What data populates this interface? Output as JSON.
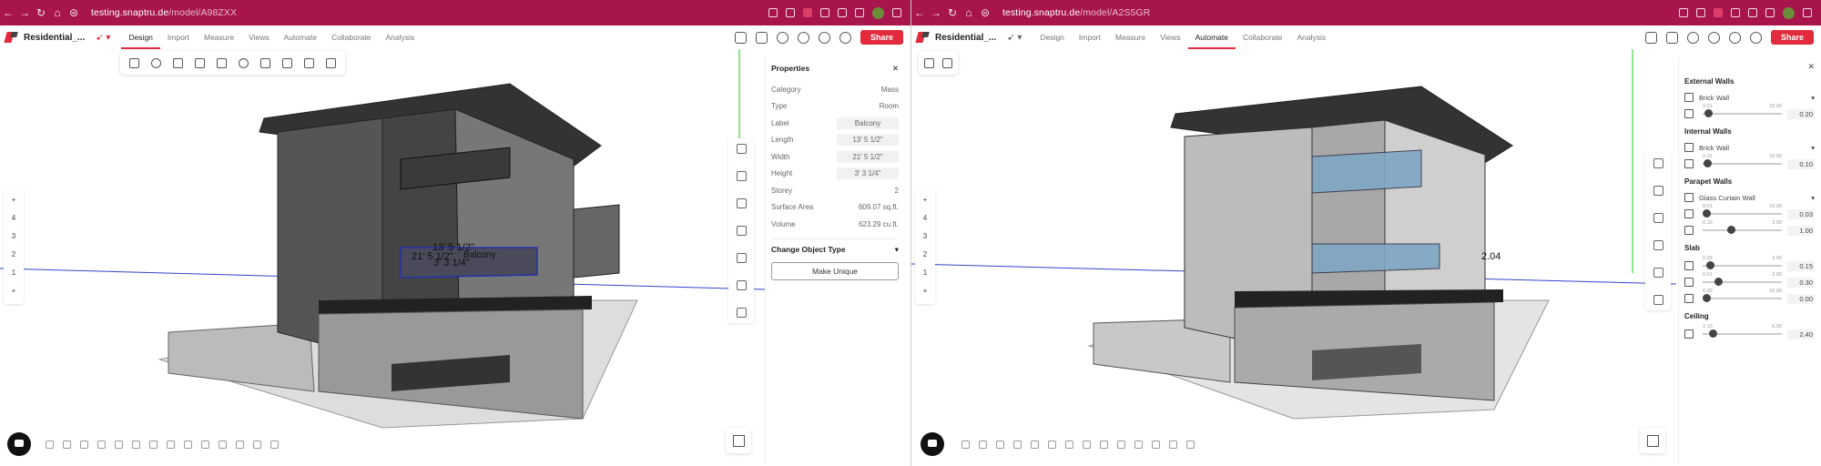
{
  "left": {
    "url_host": "testing.snaptru.de",
    "url_path": "/model/A98ZXX",
    "project": "Residential_...",
    "tabs": [
      "Design",
      "Import",
      "Measure",
      "Views",
      "Automate",
      "Collaborate",
      "Analysis"
    ],
    "active_tab": "Design",
    "share": "Share",
    "storeys": [
      "+",
      "4",
      "3",
      "2",
      "1",
      "+"
    ],
    "properties": {
      "title": "Properties",
      "rows": [
        {
          "label": "Category",
          "value": "Mass"
        },
        {
          "label": "Type",
          "value": "Room"
        },
        {
          "label": "Label",
          "value": "Balcony"
        },
        {
          "label": "Length",
          "value": "13' 5 1/2\""
        },
        {
          "label": "Width",
          "value": "21' 5 1/2\""
        },
        {
          "label": "Height",
          "value": "3' 3 1/4\""
        },
        {
          "label": "Storey",
          "value": "2"
        },
        {
          "label": "Surface Area",
          "value": "609.07 sq.ft."
        },
        {
          "label": "Volume",
          "value": "623.29 cu.ft."
        }
      ],
      "change_object_type": "Change Object Type",
      "make_unique": "Make Unique"
    },
    "scene_labels": {
      "dim1": "13' 5 1/2\"",
      "dim2": "21' 5 1/2\"",
      "dim3": "3' 3 1/4\"",
      "room": "Balcony"
    }
  },
  "right": {
    "url_host": "testing.snaptru.de",
    "url_path": "/model/A2S5GR",
    "project": "Residential_...",
    "tabs": [
      "Design",
      "Import",
      "Measure",
      "Views",
      "Automate",
      "Collaborate",
      "Analysis"
    ],
    "active_tab": "Automate",
    "share": "Share",
    "storeys": [
      "+",
      "4",
      "3",
      "2",
      "1",
      "+"
    ],
    "scene_label": "2.04",
    "automate": {
      "groups": [
        {
          "title": "External Walls",
          "select": "Brick Wall",
          "sliders": [
            {
              "min": "0.01",
              "max": "10.00",
              "value": "0.20",
              "frac": 0.02
            }
          ]
        },
        {
          "title": "Internal Walls",
          "select": "Brick Wall",
          "sliders": [
            {
              "min": "0.01",
              "max": "10.00",
              "value": "0.10",
              "frac": 0.01
            }
          ]
        },
        {
          "title": "Parapet Walls",
          "select": "Glass Curtain Wall",
          "sliders": [
            {
              "min": "0.01",
              "max": "10.00",
              "value": "0.03",
              "frac": 0.0
            },
            {
              "min": "0.10",
              "max": "3.00",
              "value": "1.00",
              "frac": 0.31
            }
          ]
        },
        {
          "title": "Slab",
          "select": "",
          "sliders": [
            {
              "min": "0.05",
              "max": "2.00",
              "value": "0.15",
              "frac": 0.05
            },
            {
              "min": "0.01",
              "max": "2.00",
              "value": "0.30",
              "frac": 0.15
            },
            {
              "min": "0.00",
              "max": "10.00",
              "value": "0.00",
              "frac": 0.0
            }
          ]
        },
        {
          "title": "Ceiling",
          "select": "",
          "sliders": [
            {
              "min": "2.10",
              "max": "6.00",
              "value": "2.40",
              "frac": 0.08
            }
          ]
        }
      ]
    }
  },
  "colors": {
    "brand": "#a8154c",
    "accent": "#e22a3c",
    "glass": "#7fa6c4"
  }
}
